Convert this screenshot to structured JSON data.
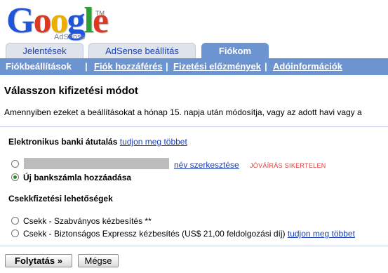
{
  "logo": {
    "brand": "Google",
    "product": "AdSense",
    "trademark": "TM"
  },
  "tabs": [
    {
      "label": "Jelentések",
      "active": false
    },
    {
      "label": "AdSense beállítás",
      "active": false
    },
    {
      "label": "Fiókom",
      "active": true
    }
  ],
  "subnav": [
    {
      "label": "Fiókbeállítások",
      "current": true
    },
    {
      "label": "Fiók hozzáférés"
    },
    {
      "label": "Fizetési előzmények"
    },
    {
      "label": "Adóinformációk"
    }
  ],
  "separator": "|",
  "page_title": "Válasszon kifizetési módot",
  "intro_text": "Amennyiben ezeket a beállításokat a hónap 15. napja után módosítja, vagy az adott havi vagy a",
  "bank_section": {
    "title": "Elektronikus banki átutalás",
    "learn_more": "tudjon meg többet",
    "existing_account": {
      "edit_name": "név szerkesztése",
      "status": "JÓVÁÍRÁS SIKERTELEN",
      "selected": false
    },
    "add_account": {
      "label": "Új bankszámla hozzáadása",
      "selected": true
    }
  },
  "check_section": {
    "title": "Csekkfizetési lehetőségek",
    "options": [
      {
        "label": "Csekk - Szabványos kézbesítés **",
        "selected": false
      },
      {
        "label": "Csekk - Biztonságos Expressz kézbesítés (US$ 21,00 feldolgozási díj)",
        "selected": false,
        "learn_more": "tudjon meg többet"
      }
    ]
  },
  "buttons": {
    "continue": "Folytatás »",
    "cancel": "Mégse"
  },
  "colors": {
    "tab_active": "#6c94d0",
    "link": "#1a3fb5",
    "status_red": "#e03a3a"
  }
}
